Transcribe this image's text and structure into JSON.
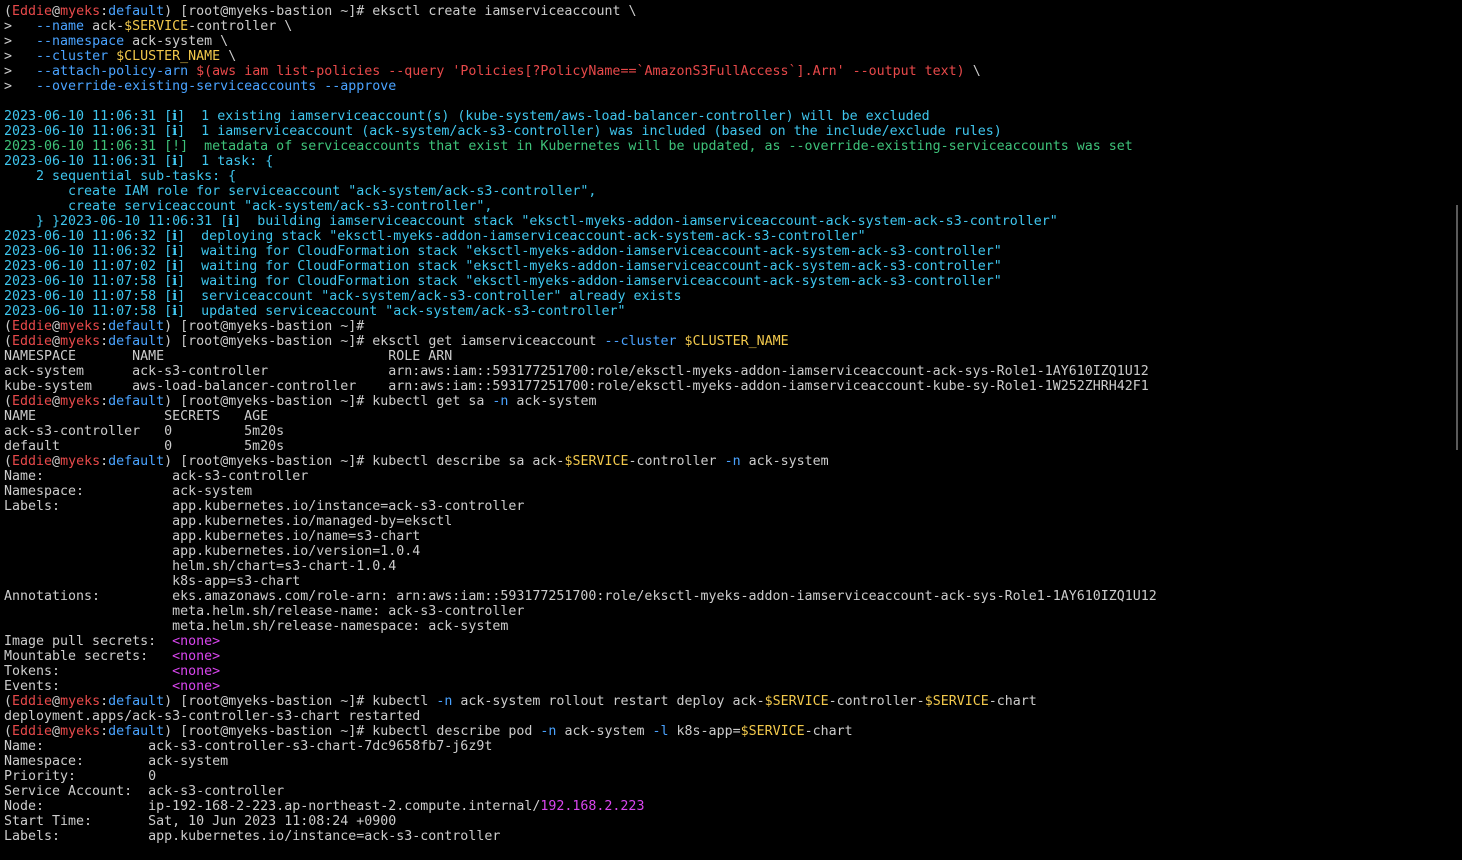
{
  "colors": {
    "background": "#000000",
    "default": "#cccccc",
    "red": "#e8494a",
    "yellow": "#f2c94c",
    "cyan": "#3fc6ee",
    "green": "#3ec27a",
    "magenta": "#d946ef",
    "blue": "#4aa3ff"
  },
  "terminal_lines": [
    [
      [
        "default",
        "("
      ],
      [
        "red",
        "Eddie"
      ],
      [
        "default",
        "@"
      ],
      [
        "red",
        "myeks"
      ],
      [
        "default",
        ":"
      ],
      [
        "blue",
        "default"
      ],
      [
        "default",
        ") [root@myeks-bastion ~]# eksctl create iamserviceaccount \\"
      ]
    ],
    [
      [
        "default",
        ">   "
      ],
      [
        "blue",
        "--name"
      ],
      [
        "default",
        " ack-"
      ],
      [
        "yellow",
        "$SERVICE"
      ],
      [
        "default",
        "-controller \\"
      ]
    ],
    [
      [
        "default",
        ">   "
      ],
      [
        "blue",
        "--namespace"
      ],
      [
        "default",
        " ack-system \\"
      ]
    ],
    [
      [
        "default",
        ">   "
      ],
      [
        "blue",
        "--cluster"
      ],
      [
        "default",
        " "
      ],
      [
        "yellow",
        "$CLUSTER_NAME"
      ],
      [
        "default",
        " \\"
      ]
    ],
    [
      [
        "default",
        ">   "
      ],
      [
        "blue",
        "--attach-policy-arn"
      ],
      [
        "default",
        " "
      ],
      [
        "red",
        "$(aws iam list-policies --query 'Policies[?PolicyName==`AmazonS3FullAccess`].Arn' --output text)"
      ],
      [
        "default",
        " \\"
      ]
    ],
    [
      [
        "default",
        ">   "
      ],
      [
        "blue",
        "--override-existing-serviceaccounts --approve"
      ]
    ],
    [
      [
        "default",
        ""
      ]
    ],
    [
      [
        "cyan",
        "2023-06-10 11:06:31 [ℹ]  1 existing iamserviceaccount(s) (kube-system/aws-load-balancer-controller) will be excluded"
      ]
    ],
    [
      [
        "cyan",
        "2023-06-10 11:06:31 [ℹ]  1 iamserviceaccount (ack-system/ack-s3-controller) was included (based on the include/exclude rules)"
      ]
    ],
    [
      [
        "green",
        "2023-06-10 11:06:31 [!]  metadata of serviceaccounts that exist in Kubernetes will be updated, as --override-existing-serviceaccounts was set"
      ]
    ],
    [
      [
        "cyan",
        "2023-06-10 11:06:31 [ℹ]  1 task: {"
      ]
    ],
    [
      [
        "cyan",
        "    2 sequential sub-tasks: {"
      ]
    ],
    [
      [
        "cyan",
        "        create IAM role for serviceaccount \"ack-system/ack-s3-controller\","
      ]
    ],
    [
      [
        "cyan",
        "        create serviceaccount \"ack-system/ack-s3-controller\","
      ]
    ],
    [
      [
        "cyan",
        "    } }2023-06-10 11:06:31 [ℹ]  building iamserviceaccount stack \"eksctl-myeks-addon-iamserviceaccount-ack-system-ack-s3-controller\""
      ]
    ],
    [
      [
        "cyan",
        "2023-06-10 11:06:32 [ℹ]  deploying stack \"eksctl-myeks-addon-iamserviceaccount-ack-system-ack-s3-controller\""
      ]
    ],
    [
      [
        "cyan",
        "2023-06-10 11:06:32 [ℹ]  waiting for CloudFormation stack \"eksctl-myeks-addon-iamserviceaccount-ack-system-ack-s3-controller\""
      ]
    ],
    [
      [
        "cyan",
        "2023-06-10 11:07:02 [ℹ]  waiting for CloudFormation stack \"eksctl-myeks-addon-iamserviceaccount-ack-system-ack-s3-controller\""
      ]
    ],
    [
      [
        "cyan",
        "2023-06-10 11:07:58 [ℹ]  waiting for CloudFormation stack \"eksctl-myeks-addon-iamserviceaccount-ack-system-ack-s3-controller\""
      ]
    ],
    [
      [
        "cyan",
        "2023-06-10 11:07:58 [ℹ]  serviceaccount \"ack-system/ack-s3-controller\" already exists"
      ]
    ],
    [
      [
        "cyan",
        "2023-06-10 11:07:58 [ℹ]  updated serviceaccount \"ack-system/ack-s3-controller\""
      ]
    ],
    [
      [
        "default",
        "("
      ],
      [
        "red",
        "Eddie"
      ],
      [
        "default",
        "@"
      ],
      [
        "red",
        "myeks"
      ],
      [
        "default",
        ":"
      ],
      [
        "blue",
        "default"
      ],
      [
        "default",
        ") [root@myeks-bastion ~]#"
      ]
    ],
    [
      [
        "default",
        "("
      ],
      [
        "red",
        "Eddie"
      ],
      [
        "default",
        "@"
      ],
      [
        "red",
        "myeks"
      ],
      [
        "default",
        ":"
      ],
      [
        "blue",
        "default"
      ],
      [
        "default",
        ") [root@myeks-bastion ~]# eksctl get iamserviceaccount "
      ],
      [
        "blue",
        "--cluster"
      ],
      [
        "default",
        " "
      ],
      [
        "yellow",
        "$CLUSTER_NAME"
      ]
    ],
    [
      [
        "default",
        "NAMESPACE       NAME                            ROLE ARN"
      ]
    ],
    [
      [
        "default",
        "ack-system      ack-s3-controller               arn:aws:iam::593177251700:role/eksctl-myeks-addon-iamserviceaccount-ack-sys-Role1-1AY610IZQ1U12"
      ]
    ],
    [
      [
        "default",
        "kube-system     aws-load-balancer-controller    arn:aws:iam::593177251700:role/eksctl-myeks-addon-iamserviceaccount-kube-sy-Role1-1W252ZHRH42F1"
      ]
    ],
    [
      [
        "default",
        "("
      ],
      [
        "red",
        "Eddie"
      ],
      [
        "default",
        "@"
      ],
      [
        "red",
        "myeks"
      ],
      [
        "default",
        ":"
      ],
      [
        "blue",
        "default"
      ],
      [
        "default",
        ") [root@myeks-bastion ~]# kubectl get sa "
      ],
      [
        "blue",
        "-n"
      ],
      [
        "default",
        " ack-system"
      ]
    ],
    [
      [
        "default",
        "NAME                SECRETS   AGE"
      ]
    ],
    [
      [
        "default",
        "ack-s3-controller   0         5m20s"
      ]
    ],
    [
      [
        "default",
        "default             0         5m20s"
      ]
    ],
    [
      [
        "default",
        "("
      ],
      [
        "red",
        "Eddie"
      ],
      [
        "default",
        "@"
      ],
      [
        "red",
        "myeks"
      ],
      [
        "default",
        ":"
      ],
      [
        "blue",
        "default"
      ],
      [
        "default",
        ") [root@myeks-bastion ~]# kubectl describe sa ack-"
      ],
      [
        "yellow",
        "$SERVICE"
      ],
      [
        "default",
        "-controller "
      ],
      [
        "blue",
        "-n"
      ],
      [
        "default",
        " ack-system"
      ]
    ],
    [
      [
        "default",
        "Name:                ack-s3-controller"
      ]
    ],
    [
      [
        "default",
        "Namespace:           ack-system"
      ]
    ],
    [
      [
        "default",
        "Labels:              app.kubernetes.io/instance=ack-s3-controller"
      ]
    ],
    [
      [
        "default",
        "                     app.kubernetes.io/managed-by=eksctl"
      ]
    ],
    [
      [
        "default",
        "                     app.kubernetes.io/name=s3-chart"
      ]
    ],
    [
      [
        "default",
        "                     app.kubernetes.io/version=1.0.4"
      ]
    ],
    [
      [
        "default",
        "                     helm.sh/chart=s3-chart-1.0.4"
      ]
    ],
    [
      [
        "default",
        "                     k8s-app=s3-chart"
      ]
    ],
    [
      [
        "default",
        "Annotations:         eks.amazonaws.com/role-arn: arn:aws:iam::593177251700:role/eksctl-myeks-addon-iamserviceaccount-ack-sys-Role1-1AY610IZQ1U12"
      ]
    ],
    [
      [
        "default",
        "                     meta.helm.sh/release-name: ack-s3-controller"
      ]
    ],
    [
      [
        "default",
        "                     meta.helm.sh/release-namespace: ack-system"
      ]
    ],
    [
      [
        "default",
        "Image pull secrets:  "
      ],
      [
        "magenta",
        "<none>"
      ]
    ],
    [
      [
        "default",
        "Mountable secrets:   "
      ],
      [
        "magenta",
        "<none>"
      ]
    ],
    [
      [
        "default",
        "Tokens:              "
      ],
      [
        "magenta",
        "<none>"
      ]
    ],
    [
      [
        "default",
        "Events:              "
      ],
      [
        "magenta",
        "<none>"
      ]
    ],
    [
      [
        "default",
        "("
      ],
      [
        "red",
        "Eddie"
      ],
      [
        "default",
        "@"
      ],
      [
        "red",
        "myeks"
      ],
      [
        "default",
        ":"
      ],
      [
        "blue",
        "default"
      ],
      [
        "default",
        ") [root@myeks-bastion ~]# kubectl "
      ],
      [
        "blue",
        "-n"
      ],
      [
        "default",
        " ack-system rollout restart deploy ack-"
      ],
      [
        "yellow",
        "$SERVICE"
      ],
      [
        "default",
        "-controller-"
      ],
      [
        "yellow",
        "$SERVICE"
      ],
      [
        "default",
        "-chart"
      ]
    ],
    [
      [
        "default",
        "deployment.apps/ack-s3-controller-s3-chart restarted"
      ]
    ],
    [
      [
        "default",
        "("
      ],
      [
        "red",
        "Eddie"
      ],
      [
        "default",
        "@"
      ],
      [
        "red",
        "myeks"
      ],
      [
        "default",
        ":"
      ],
      [
        "blue",
        "default"
      ],
      [
        "default",
        ") [root@myeks-bastion ~]# kubectl describe pod "
      ],
      [
        "blue",
        "-n"
      ],
      [
        "default",
        " ack-system "
      ],
      [
        "blue",
        "-l"
      ],
      [
        "default",
        " k8s-app="
      ],
      [
        "yellow",
        "$SERVICE"
      ],
      [
        "default",
        "-chart"
      ]
    ],
    [
      [
        "default",
        "Name:             ack-s3-controller-s3-chart-7dc9658fb7-j6z9t"
      ]
    ],
    [
      [
        "default",
        "Namespace:        ack-system"
      ]
    ],
    [
      [
        "default",
        "Priority:         0"
      ]
    ],
    [
      [
        "default",
        "Service Account:  ack-s3-controller"
      ]
    ],
    [
      [
        "default",
        "Node:             ip-192-168-2-223.ap-northeast-2.compute.internal/"
      ],
      [
        "magenta",
        "192.168.2.223"
      ]
    ],
    [
      [
        "default",
        "Start Time:       Sat, 10 Jun 2023 11:08:24 +0900"
      ]
    ],
    [
      [
        "default",
        "Labels:           app.kubernetes.io/instance=ack-s3-controller"
      ]
    ]
  ]
}
